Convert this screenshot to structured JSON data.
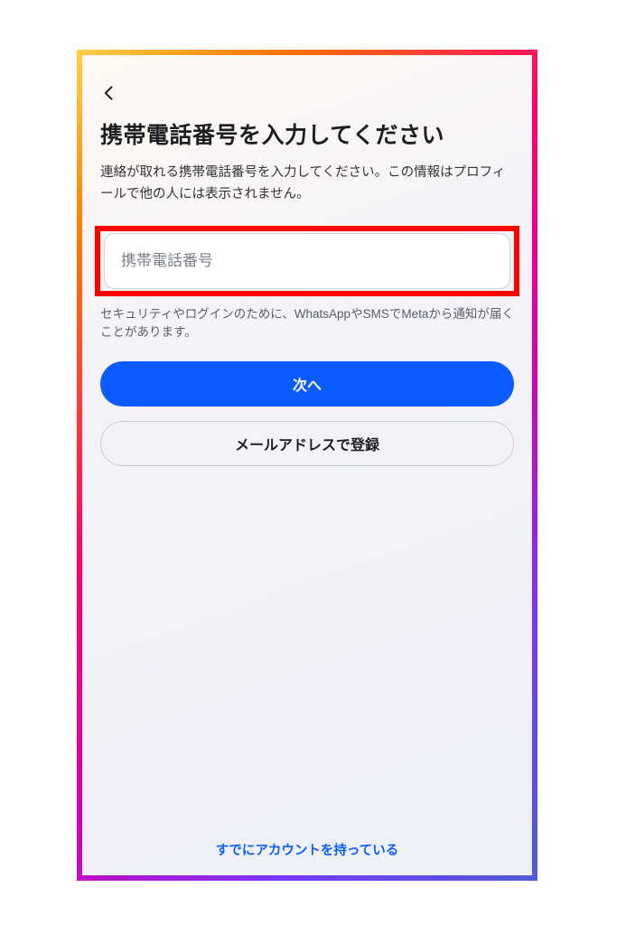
{
  "header": {
    "back_icon": "chevron-left"
  },
  "page": {
    "title": "携帯電話番号を入力してください",
    "subtitle": "連絡が取れる携帯電話番号を入力してください。この情報はプロフィールで他の人には表示されません。"
  },
  "form": {
    "phone_placeholder": "携帯電話番号",
    "phone_value": "",
    "hint": "セキュリティやログインのために、WhatsAppやSMSでMetaから通知が届くことがあります。"
  },
  "buttons": {
    "next_label": "次へ",
    "email_signup_label": "メールアドレスで登録"
  },
  "footer": {
    "existing_account_label": "すでにアカウントを持っている"
  },
  "colors": {
    "primary": "#0b5cff",
    "highlight_border": "#ff0000"
  }
}
